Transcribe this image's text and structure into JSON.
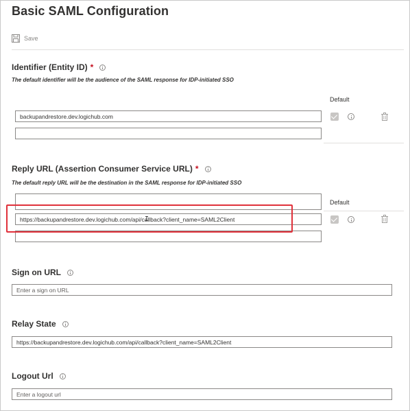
{
  "page": {
    "title": "Basic SAML Configuration"
  },
  "toolbar": {
    "save_label": "Save",
    "save_icon": "save-icon"
  },
  "identifier": {
    "title": "Identifier (Entity ID)",
    "required_mark": "*",
    "description": "The default identifier will be the audience of the SAML response for IDP-initiated SSO",
    "default_header": "Default",
    "rows": [
      {
        "value": "backupandrestore.dev.logichub.com",
        "default_checked": true
      },
      {
        "value": ""
      }
    ]
  },
  "reply_url": {
    "title": "Reply URL (Assertion Consumer Service URL)",
    "required_mark": "*",
    "description": "The default reply URL will be the destination in the SAML response for IDP-initiated SSO",
    "default_header": "Default",
    "rows": [
      {
        "value": ""
      },
      {
        "value": "https://backupandrestore.dev.logichub.com/api/callback?client_name=SAML2Client",
        "default_checked": true
      },
      {
        "value": ""
      }
    ]
  },
  "sign_on_url": {
    "title": "Sign on URL",
    "placeholder": "Enter a sign on URL"
  },
  "relay_state": {
    "title": "Relay State",
    "value": "https://backupandrestore.dev.logichub.com/api/callback?client_name=SAML2Client"
  },
  "logout_url": {
    "title": "Logout Url",
    "placeholder": "Enter a logout url"
  },
  "colors": {
    "highlight": "#e0303a",
    "required": "#c50f1f",
    "border": "#8a8886"
  }
}
